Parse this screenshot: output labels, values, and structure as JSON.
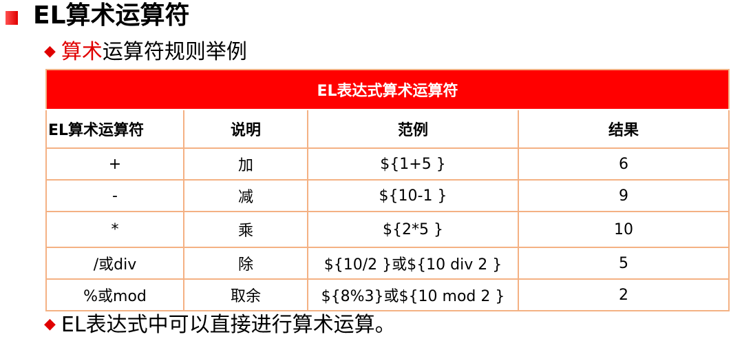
{
  "slide": {
    "title": "EL算术运算符",
    "bullet1": {
      "accent": "算术",
      "rest": "运算符规则举例"
    },
    "bullet2": "EL表达式中可以直接进行算术运算。",
    "diamond": "◆"
  },
  "table": {
    "caption": "EL表达式算术运算符",
    "headers": [
      "EL算术运算符",
      "说明",
      "范例",
      "结果"
    ],
    "rows": [
      [
        "+",
        "加",
        "${1+5 }",
        "6"
      ],
      [
        "-",
        "减",
        "${10-1 }",
        "9"
      ],
      [
        "*",
        "乘",
        "${2*5  }",
        "10"
      ],
      [
        "/或div",
        "除",
        "${10/2 }或${10 div 2 }",
        "5"
      ],
      [
        "%或mod",
        "取余",
        "${8%3}或${10 mod 2 }",
        "2"
      ]
    ]
  },
  "colors": {
    "accent": "#e00000",
    "table_header_bg": "#ff0000",
    "table_border": "#f4b183"
  }
}
